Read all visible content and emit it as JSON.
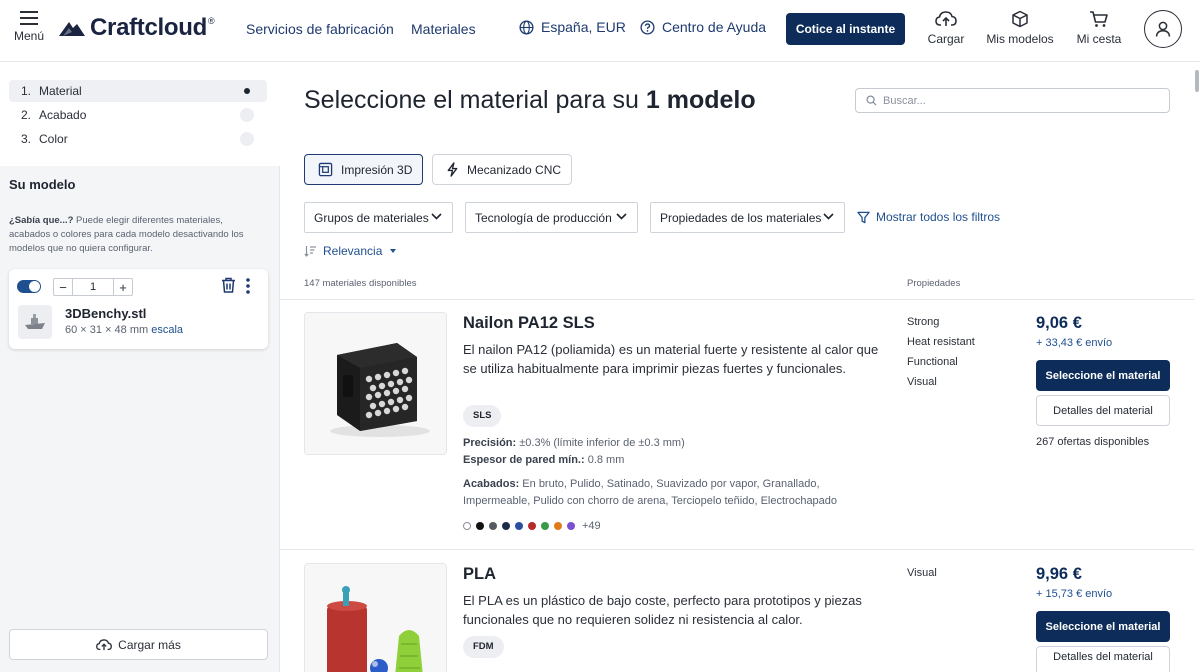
{
  "header": {
    "menu_label": "Menú",
    "logo_text": "Craftcloud",
    "logo_reg": "®",
    "nav_services": "Servicios de fabricación",
    "nav_materials": "Materiales",
    "region": "España, EUR",
    "help": "Centro de Ayuda",
    "quote_button": "Cotice al instante",
    "upload": "Cargar",
    "my_models": "Mis modelos",
    "cart": "Mi cesta"
  },
  "sidebar": {
    "steps": [
      {
        "num": "1.",
        "label": "Material",
        "state": "active"
      },
      {
        "num": "2.",
        "label": "Acabado",
        "state": "pending"
      },
      {
        "num": "3.",
        "label": "Color",
        "state": "pending"
      }
    ],
    "your_model_title": "Su modelo",
    "tip_bold": "¿Sabía que...?",
    "tip_text": " Puede elegir diferentes materiales, acabados o colores para cada modelo desactivando los modelos que no quiera configurar.",
    "model": {
      "quantity": "1",
      "filename": "3DBenchy.stl",
      "dimensions": "60 × 31 × 48 mm",
      "scale_link": "escala",
      "minus": "−",
      "plus": "+"
    },
    "load_more": "Cargar más"
  },
  "main": {
    "title_prefix": "Seleccione el material para su ",
    "title_bold": "1 modelo",
    "search_placeholder": "Buscar...",
    "process_tabs": [
      {
        "label": "Impresión 3D",
        "active": true
      },
      {
        "label": "Mecanizado CNC",
        "active": false
      }
    ],
    "filters": [
      "Grupos de materiales",
      "Tecnología de producción",
      "Propiedades de los materiales"
    ],
    "show_all_filters": "Mostrar todos los filtros",
    "sort_label": "Relevancia",
    "count_label": "147 materiales disponibles",
    "properties_header": "Propiedades"
  },
  "materials": [
    {
      "name": "Nailon PA12 SLS",
      "description": "El nailon PA12 (poliamida) es un material fuerte y resistente al calor que se utiliza habitualmente para imprimir piezas fuertes y funcionales.",
      "tech": "SLS",
      "precision_label": "Precisión:",
      "precision_value": " ±0.3% (límite inferior de ±0.3 mm)",
      "wall_label": "Espesor de pared mín.:",
      "wall_value": " 0.8 mm",
      "finishes_label": "Acabados:",
      "finishes_value": " En bruto, Pulido, Satinado, Suavizado por vapor, Granallado, Impermeable, Pulido con chorro de arena, Terciopelo teñido, Electrochapado",
      "colors": [
        "#ffffff",
        "#111111",
        "#555a60",
        "#1d2b4a",
        "#2a4fa0",
        "#b52a2a",
        "#3a9a4a",
        "#e07a1a",
        "#7a4fd0"
      ],
      "more_colors": "+49",
      "properties": [
        "Strong",
        "Heat resistant",
        "Functional",
        "Visual"
      ],
      "price": "9,06 €",
      "shipping": "+ 33,43 € envío",
      "select_label": "Seleccione el material",
      "details_label": "Detalles del material",
      "offers": "267 ofertas disponibles"
    },
    {
      "name": "PLA",
      "description": "El PLA es un plástico de bajo coste, perfecto para prototipos y piezas funcionales que no requieren solidez ni resistencia al calor.",
      "tech": "FDM",
      "properties": [
        "Visual"
      ],
      "price": "9,96 €",
      "shipping": "+ 15,73 € envío",
      "select_label": "Seleccione el material",
      "details_label": "Detalles del material"
    }
  ]
}
